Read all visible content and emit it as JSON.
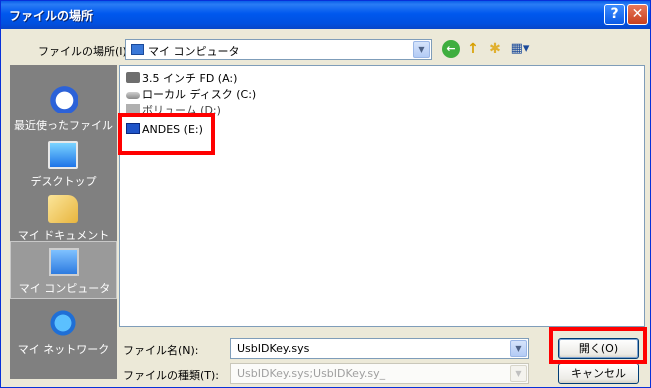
{
  "window": {
    "title": "ファイルの場所"
  },
  "lookin": {
    "label": "ファイルの場所(I):",
    "value": "マイ コンピュータ"
  },
  "toolbar": {
    "back": "←",
    "up": "↑",
    "new_folder": "✱",
    "views": "▦▾"
  },
  "places": [
    {
      "label": "最近使ったファイル"
    },
    {
      "label": "デスクトップ"
    },
    {
      "label": "マイ ドキュメント"
    },
    {
      "label": "マイ コンピュータ"
    },
    {
      "label": "マイ ネットワーク"
    }
  ],
  "files": [
    {
      "label": "3.5 インチ FD (A:)",
      "icon": "floppy-drive-icon"
    },
    {
      "label": "ローカル ディスク (C:)",
      "icon": "hard-disk-icon"
    },
    {
      "label": "ボリューム (D:)",
      "icon": "volume-icon"
    },
    {
      "label": "ANDES (E:)",
      "icon": "andes-drive-icon"
    }
  ],
  "filename": {
    "label": "ファイル名(N):",
    "value": "UsbIDKey.sys"
  },
  "filetype": {
    "label": "ファイルの種類(T):",
    "value": "UsbIDKey.sys;UsbIDKey.sy_"
  },
  "buttons": {
    "open": "開く(O)",
    "cancel": "キャンセル"
  },
  "colors": {
    "titlebar": "#0058ee",
    "dialog_bg": "#ece9d8",
    "places_bg": "#808080",
    "highlight": "#ff0000"
  }
}
